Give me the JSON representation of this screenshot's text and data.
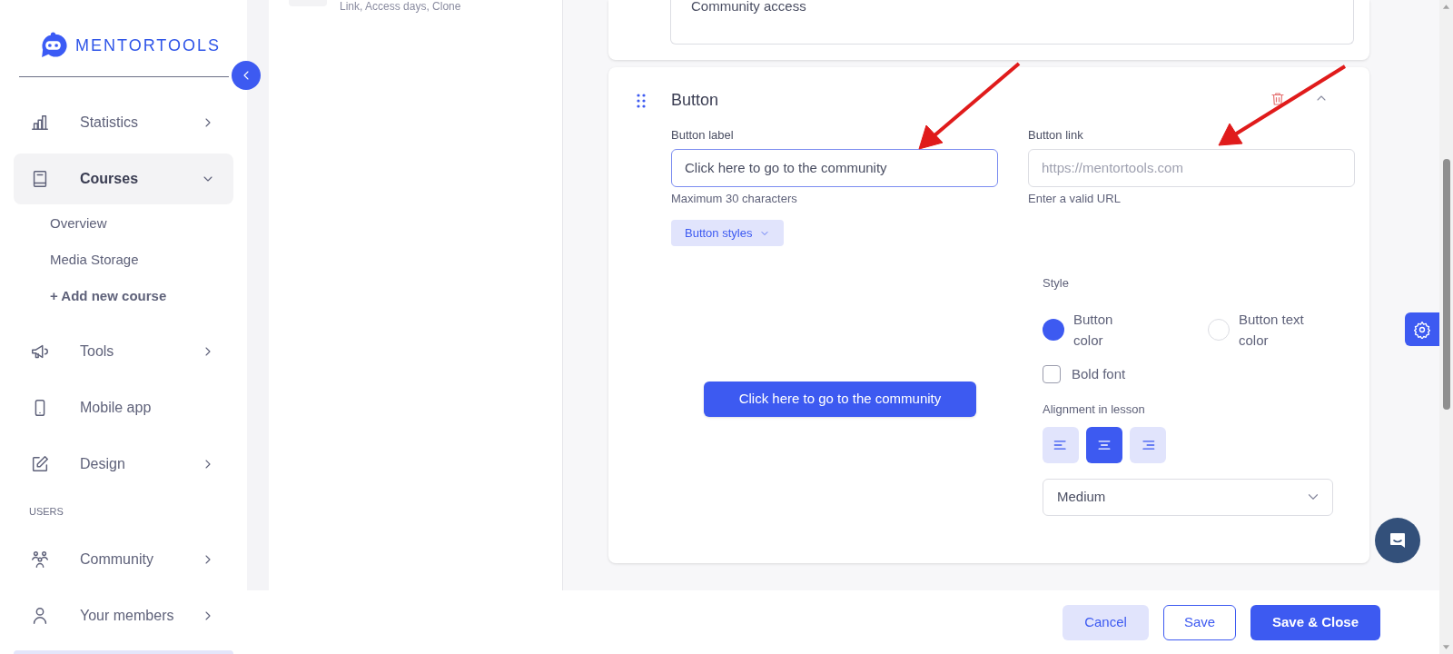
{
  "sidebar": {
    "logo": "MENTORTOOLS",
    "items": [
      {
        "kind": "group",
        "label": "Statistics",
        "selected": false,
        "expanded": false
      },
      {
        "kind": "group",
        "label": "Courses",
        "selected": true,
        "expanded": true,
        "children": [
          {
            "kind": "page",
            "label": "Overview"
          },
          {
            "kind": "page",
            "label": "Media Storage"
          },
          {
            "kind": "action",
            "label": "+ Add new course"
          }
        ]
      },
      {
        "kind": "group",
        "label": "Tools",
        "selected": false,
        "expanded": false
      },
      {
        "kind": "link",
        "label": "Mobile app",
        "selected": false
      },
      {
        "kind": "group",
        "label": "Design",
        "selected": false,
        "expanded": false
      },
      {
        "kind": "section",
        "label": "USERS"
      },
      {
        "kind": "group",
        "label": "Community",
        "selected": false,
        "expanded": false
      },
      {
        "kind": "group",
        "label": "Your members",
        "selected": false,
        "expanded": false
      }
    ]
  },
  "list_panel": {
    "item_meta": "Link, Access days, Clone"
  },
  "text_block": {
    "value": "Community access"
  },
  "button_block": {
    "title": "Button",
    "expanded": true,
    "label_field": {
      "label": "Button label",
      "value": "Click here to go to the community",
      "hint": "Maximum 30 characters",
      "focused": true
    },
    "link_field": {
      "label": "Button link",
      "placeholder": "https://mentortools.com",
      "hint": "Enter a valid URL"
    },
    "styles_toggle": "Button styles",
    "preview_button": "Click here to go to the community",
    "style_label": "Style",
    "style_options": [
      {
        "label": "Button\ncolor",
        "selected": true
      },
      {
        "label": "Button text\ncolor",
        "selected": false
      }
    ],
    "bold_font": {
      "label": "Bold font",
      "checked": false
    },
    "alignment_label": "Alignment in lesson",
    "alignments": [
      {
        "kind": "left",
        "selected": false
      },
      {
        "kind": "center",
        "selected": true
      },
      {
        "kind": "right",
        "selected": false
      }
    ],
    "size_select": "Medium"
  },
  "footer": {
    "buttons": [
      {
        "kind": "secondary",
        "label": "Cancel"
      },
      {
        "kind": "outline",
        "label": "Save"
      },
      {
        "kind": "primary",
        "label": "Save & Close"
      }
    ]
  }
}
